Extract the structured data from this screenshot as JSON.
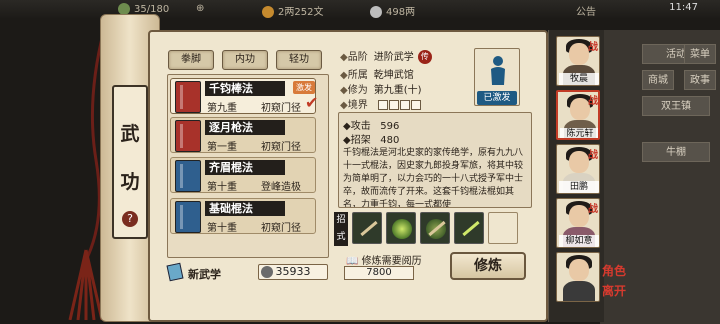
{
  "topbar": {
    "stamina": "35/180",
    "copper": "2两252文",
    "silver": "498两",
    "notice": "公告",
    "clock": "11:47"
  },
  "background_menu": [
    "活动",
    "菜单",
    "商城",
    "政事",
    "双王镇",
    "牛棚"
  ],
  "scroll": {
    "title_chars": [
      "武",
      "功"
    ],
    "help": "?"
  },
  "tabs": [
    "拳脚",
    "内功",
    "轻功"
  ],
  "skills": [
    {
      "name": "千钧棒法",
      "level": "第九重",
      "rank": "初窥门径",
      "badge": "激发",
      "checked": true,
      "color": "#a8322a",
      "active": true
    },
    {
      "name": "逐月枪法",
      "level": "第一重",
      "rank": "初窥门径",
      "badge": "",
      "checked": false,
      "color": "#a8322a",
      "active": false
    },
    {
      "name": "齐眉棍法",
      "level": "第十重",
      "rank": "登峰造极",
      "badge": "",
      "checked": false,
      "color": "#2f5f8e",
      "active": false
    },
    {
      "name": "基础棍法",
      "level": "第十重",
      "rank": "初窥门径",
      "badge": "",
      "checked": false,
      "color": "#2f5f8e",
      "active": false
    }
  ],
  "new_skill": {
    "label": "新武学",
    "points": "35933"
  },
  "detail": {
    "grade_label": "品阶",
    "grade": "进阶武学",
    "grade_seal": "传",
    "faction_label": "所属",
    "faction": "乾坤武馆",
    "cultivation_label": "修为",
    "cultivation": "第九重(十)",
    "realm_label": "境界",
    "portrait_status": "已激发",
    "attack_label": "攻击",
    "attack": "596",
    "parry_label": "招架",
    "parry": "480",
    "description": "千钧棍法是河北史家的家传绝学，原有九九八十一式棍法，因史家九郎投身军旅，将其中较为简单明了，以力会巧的一十八式授予军中士卒，故而流传了开来。这套千钧棍法棍如其名，力重千钧，每一式都使",
    "moves_label": "招式",
    "train_req_label": "修炼需要阅历",
    "train_req": "7800",
    "train_button": "修炼"
  },
  "characters": [
    {
      "name": "牧晨",
      "battle": "战"
    },
    {
      "name": "陈元轩",
      "battle": "战"
    },
    {
      "name": "田鹏",
      "battle": "战"
    },
    {
      "name": "柳如意",
      "battle": "战"
    },
    {
      "name": "",
      "battle": ""
    }
  ],
  "side_red_texts": [
    "角色",
    "离开"
  ],
  "colors": {
    "accent": "#c23b26",
    "panel": "#efe6cf",
    "dark": "#231f1b"
  }
}
